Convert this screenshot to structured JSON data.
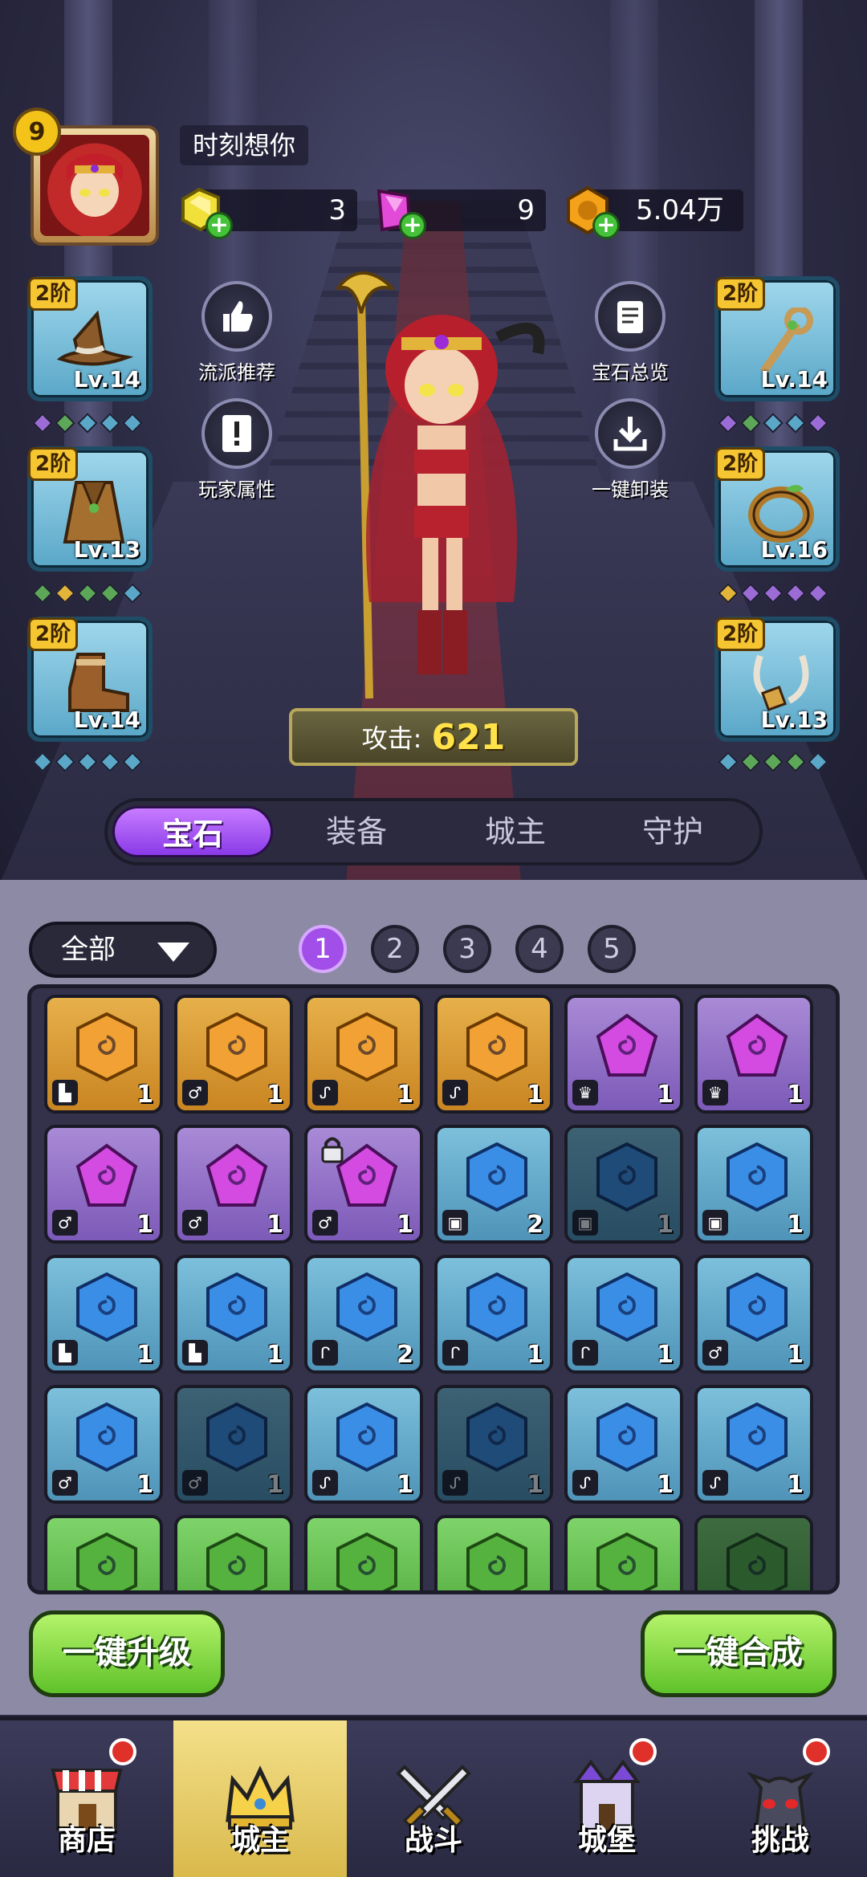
{
  "player": {
    "level": "9",
    "name": "时刻想你"
  },
  "resources": [
    {
      "name": "gold-crystal",
      "value": "3"
    },
    {
      "name": "pink-crystal",
      "value": "9"
    },
    {
      "name": "coin",
      "value": "5.04万"
    }
  ],
  "equipment_left": [
    {
      "tier": "2阶",
      "level": "Lv.14",
      "item": "wizard-hat"
    },
    {
      "tier": "2阶",
      "level": "Lv.13",
      "item": "cloak"
    },
    {
      "tier": "2阶",
      "level": "Lv.14",
      "item": "boots"
    }
  ],
  "equipment_right": [
    {
      "tier": "2阶",
      "level": "Lv.14",
      "item": "staff"
    },
    {
      "tier": "2阶",
      "level": "Lv.16",
      "item": "ring"
    },
    {
      "tier": "2阶",
      "level": "Lv.13",
      "item": "necklace"
    }
  ],
  "actions": {
    "build_recommend": "流派推荐",
    "player_attributes": "玩家属性",
    "gem_overview": "宝石总览",
    "unequip_all": "一键卸装"
  },
  "attack": {
    "label": "攻击:",
    "value": "621"
  },
  "tabs": [
    "宝石",
    "装备",
    "城主",
    "守护"
  ],
  "filter": {
    "label": "全部"
  },
  "pages": [
    "1",
    "2",
    "3",
    "4",
    "5"
  ],
  "gem_rows": [
    [
      {
        "color": "orange",
        "count": "1",
        "type": "boot"
      },
      {
        "color": "orange",
        "count": "1",
        "type": "ring"
      },
      {
        "color": "orange",
        "count": "1",
        "type": "neck"
      },
      {
        "color": "orange",
        "count": "1",
        "type": "neck"
      },
      {
        "color": "purple",
        "count": "1",
        "type": "crown"
      },
      {
        "color": "purple",
        "count": "1",
        "type": "crown"
      }
    ],
    [
      {
        "color": "purple",
        "count": "1",
        "type": "ring"
      },
      {
        "color": "purple",
        "count": "1",
        "type": "ring"
      },
      {
        "color": "purple",
        "count": "1",
        "type": "ring",
        "locked": true
      },
      {
        "color": "blue",
        "count": "2",
        "type": "shirt"
      },
      {
        "color": "blue",
        "count": "1",
        "type": "shirt",
        "dim": true
      },
      {
        "color": "blue",
        "count": "1",
        "type": "shirt"
      }
    ],
    [
      {
        "color": "blue",
        "count": "1",
        "type": "boot"
      },
      {
        "color": "blue",
        "count": "1",
        "type": "boot"
      },
      {
        "color": "blue",
        "count": "2",
        "type": "staff"
      },
      {
        "color": "blue",
        "count": "1",
        "type": "staff"
      },
      {
        "color": "blue",
        "count": "1",
        "type": "staff"
      },
      {
        "color": "blue",
        "count": "1",
        "type": "ring"
      }
    ],
    [
      {
        "color": "blue",
        "count": "1",
        "type": "ring"
      },
      {
        "color": "blue",
        "count": "1",
        "type": "ring",
        "dim": true
      },
      {
        "color": "blue",
        "count": "1",
        "type": "neck"
      },
      {
        "color": "blue",
        "count": "1",
        "type": "neck",
        "dim": true
      },
      {
        "color": "blue",
        "count": "1",
        "type": "neck"
      },
      {
        "color": "blue",
        "count": "1",
        "type": "neck"
      }
    ],
    [
      {
        "color": "green",
        "count": "",
        "type": ""
      },
      {
        "color": "green",
        "count": "",
        "type": ""
      },
      {
        "color": "green",
        "count": "",
        "type": ""
      },
      {
        "color": "green",
        "count": "",
        "type": ""
      },
      {
        "color": "green",
        "count": "",
        "type": ""
      },
      {
        "color": "green",
        "count": "",
        "type": "",
        "dim": true
      }
    ]
  ],
  "buttons": {
    "upgrade_all": "一键升级",
    "merge_all": "一键合成"
  },
  "nav": [
    {
      "label": "商店",
      "badge": true
    },
    {
      "label": "城主",
      "badge": false,
      "active": true
    },
    {
      "label": "战斗",
      "badge": false
    },
    {
      "label": "城堡",
      "badge": true
    },
    {
      "label": "挑战",
      "badge": true
    }
  ],
  "colors": {
    "tab_active": "#a24ee8",
    "attack_value": "#ffe24a",
    "button_green": "#6fd02e",
    "slot_blue": "#7cc0dc"
  }
}
